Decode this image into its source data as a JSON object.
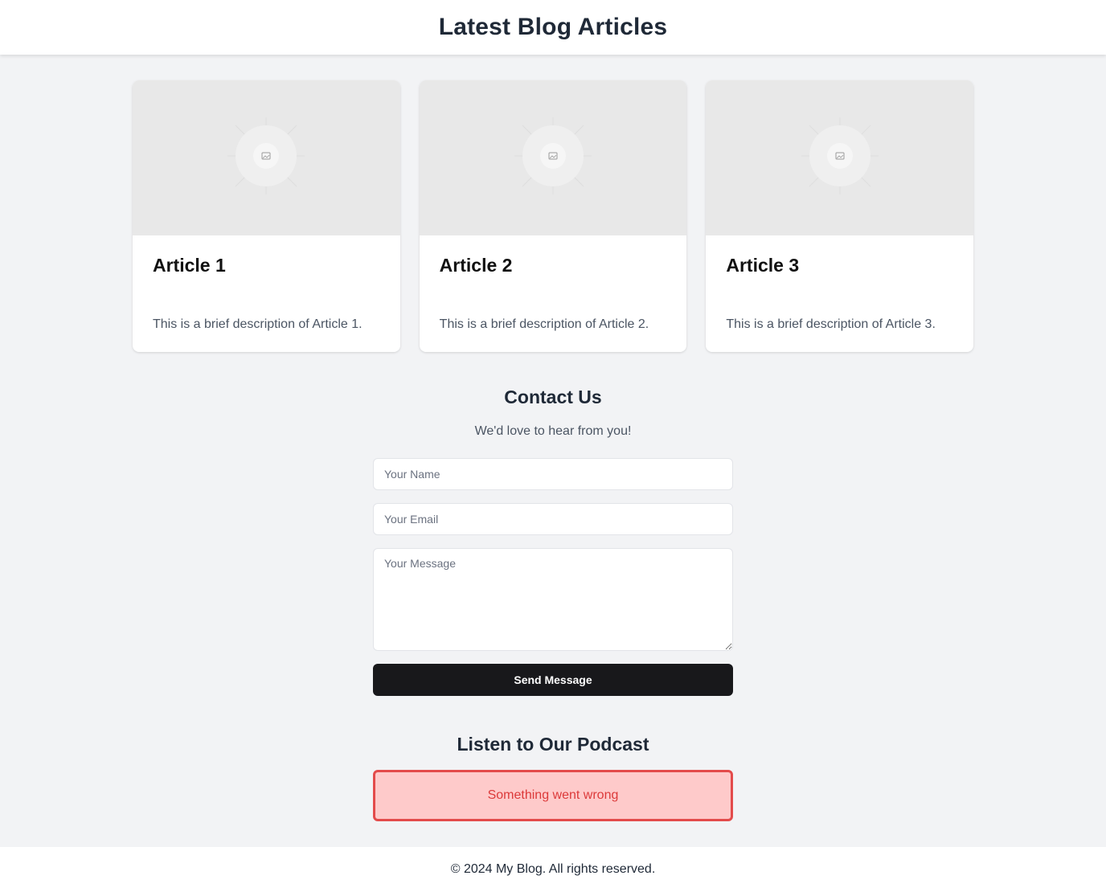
{
  "header": {
    "title": "Latest Blog Articles"
  },
  "articles": [
    {
      "title": "Article 1",
      "description": "This is a brief description of Article 1.",
      "image_icon": "image-placeholder-icon"
    },
    {
      "title": "Article 2",
      "description": "This is a brief description of Article 2.",
      "image_icon": "image-placeholder-icon"
    },
    {
      "title": "Article 3",
      "description": "This is a brief description of Article 3.",
      "image_icon": "image-placeholder-icon"
    }
  ],
  "contact": {
    "title": "Contact Us",
    "subtitle": "We'd love to hear from you!",
    "name_placeholder": "Your Name",
    "email_placeholder": "Your Email",
    "message_placeholder": "Your Message",
    "send_label": "Send Message"
  },
  "podcast": {
    "title": "Listen to Our Podcast",
    "error_message": "Something went wrong"
  },
  "footer": {
    "text": "© 2024 My Blog. All rights reserved."
  },
  "colors": {
    "page_background": "#f2f3f5",
    "button_background": "#18181b",
    "error_background": "#fecaca",
    "error_border": "#e34b4b",
    "error_text": "#dc3a3a"
  }
}
